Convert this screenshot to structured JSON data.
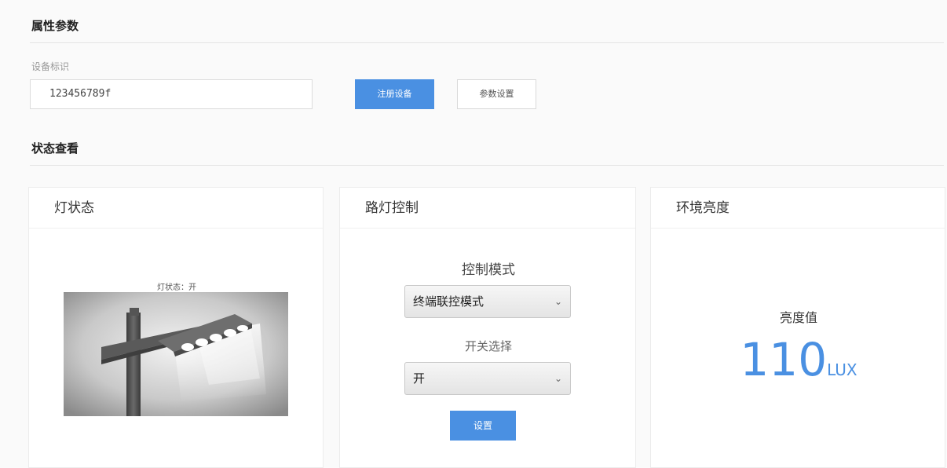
{
  "attributes": {
    "title": "属性参数",
    "device_id_label": "设备标识",
    "device_id_value": "123456789f",
    "register_button": "注册设备",
    "params_button": "参数设置"
  },
  "status": {
    "title": "状态查看"
  },
  "lamp_panel": {
    "title": "灯状态",
    "caption": "灯状态：开"
  },
  "control_panel": {
    "title": "路灯控制",
    "mode_label": "控制模式",
    "mode_selected": "终端联控模式",
    "switch_label": "开关选择",
    "switch_selected": "开",
    "set_button": "设置"
  },
  "env_panel": {
    "title": "环境亮度",
    "value_label": "亮度值",
    "value": "110",
    "unit": "LUX"
  },
  "colors": {
    "accent": "#4a90e2",
    "page_background": "#fafafa"
  }
}
